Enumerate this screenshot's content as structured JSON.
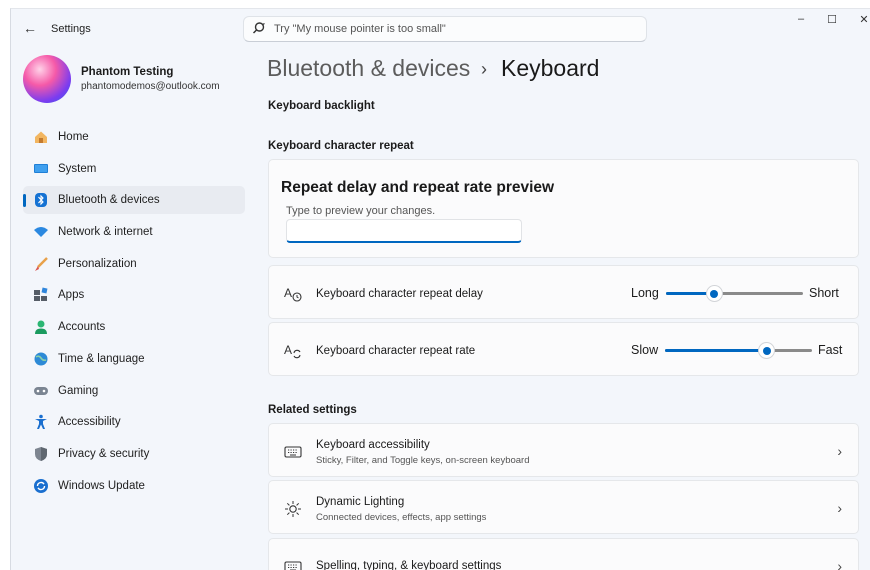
{
  "app": {
    "title": "Settings",
    "search_placeholder": "Try \"My mouse pointer is too small\"",
    "back_glyph": "←",
    "window_controls": {
      "minimize": "–",
      "maximize": "☐",
      "close": "✕"
    }
  },
  "profile": {
    "name": "Phantom Testing",
    "email": "phantomodemos@outlook.com"
  },
  "nav": {
    "items": [
      {
        "label": "Home",
        "icon": "home-icon"
      },
      {
        "label": "System",
        "icon": "system-icon"
      },
      {
        "label": "Bluetooth & devices",
        "icon": "bluetooth-icon",
        "active": true
      },
      {
        "label": "Network & internet",
        "icon": "wifi-icon"
      },
      {
        "label": "Personalization",
        "icon": "brush-icon"
      },
      {
        "label": "Apps",
        "icon": "apps-icon"
      },
      {
        "label": "Accounts",
        "icon": "accounts-icon"
      },
      {
        "label": "Time & language",
        "icon": "globe-clock-icon"
      },
      {
        "label": "Gaming",
        "icon": "gamepad-icon"
      },
      {
        "label": "Accessibility",
        "icon": "accessibility-icon"
      },
      {
        "label": "Privacy & security",
        "icon": "shield-icon"
      },
      {
        "label": "Windows Update",
        "icon": "update-icon"
      }
    ]
  },
  "breadcrumb": {
    "parent": "Bluetooth & devices",
    "separator": "›",
    "current": "Keyboard"
  },
  "main": {
    "backlight_heading": "Keyboard backlight",
    "repeat_heading": "Keyboard character repeat",
    "preview": {
      "title": "Repeat delay and repeat rate preview",
      "label": "Type to preview your changes.",
      "value": ""
    },
    "repeat_delay": {
      "label": "Keyboard character repeat delay",
      "min_label": "Long",
      "max_label": "Short",
      "value_fraction": 0.35
    },
    "repeat_rate": {
      "label": "Keyboard character repeat rate",
      "min_label": "Slow",
      "max_label": "Fast",
      "value_fraction": 0.69
    },
    "related_heading": "Related settings",
    "related": [
      {
        "title": "Keyboard accessibility",
        "desc": "Sticky, Filter, and Toggle keys, on-screen keyboard",
        "icon": "keyboard-icon"
      },
      {
        "title": "Dynamic Lighting",
        "desc": "Connected devices, effects, app settings",
        "icon": "lighting-icon"
      },
      {
        "title": "Spelling, typing, & keyboard settings",
        "desc": "",
        "icon": "keyboard-icon"
      }
    ],
    "chevron": "›"
  },
  "colors": {
    "accent": "#0067c0",
    "window_bg": "#f3f6fb",
    "card_bg": "#fbfbfc",
    "nav_active_bg": "#e8ebf1"
  }
}
